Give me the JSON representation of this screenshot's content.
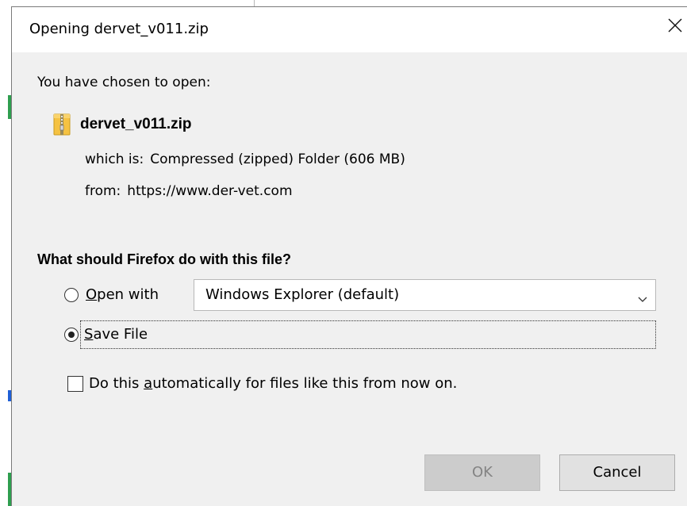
{
  "dialog": {
    "title": "Opening dervet_v011.zip",
    "intro": "You have chosen to open:",
    "file": {
      "name": "dervet_v011.zip",
      "icon": "zip-folder-icon",
      "type_label": "which is:",
      "type_value": "Compressed (zipped) Folder (606 MB)",
      "from_label": "from:",
      "from_value": "https://www.der-vet.com"
    },
    "question": "What should Firefox do with this file?",
    "open_with": {
      "mnemonic": "O",
      "rest": "pen with",
      "selected": false,
      "app_selected": "Windows Explorer (default)"
    },
    "save_file": {
      "mnemonic": "S",
      "rest": "ave File",
      "selected": true
    },
    "auto": {
      "before": "Do this ",
      "mnemonic": "a",
      "after": "utomatically for files like this from now on.",
      "checked": false
    },
    "buttons": {
      "ok": "OK",
      "ok_enabled": false,
      "cancel": "Cancel"
    }
  },
  "colors": {
    "dialog_bg": "#f0f0f0",
    "titlebar_bg": "#ffffff",
    "ok_disabled_bg": "#cccccc",
    "ok_disabled_text": "#838383",
    "cancel_bg": "#e1e1e1",
    "zip_icon_yellow": "#f5c242"
  }
}
